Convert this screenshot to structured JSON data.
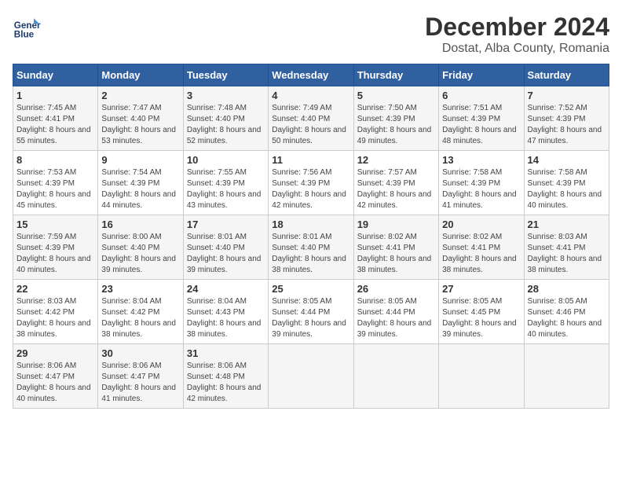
{
  "header": {
    "logo_line1": "General",
    "logo_line2": "Blue",
    "title": "December 2024",
    "subtitle": "Dostat, Alba County, Romania"
  },
  "days_of_week": [
    "Sunday",
    "Monday",
    "Tuesday",
    "Wednesday",
    "Thursday",
    "Friday",
    "Saturday"
  ],
  "weeks": [
    [
      {
        "day": 1,
        "sunrise": "7:45 AM",
        "sunset": "4:41 PM",
        "daylight": "8 hours and 55 minutes."
      },
      {
        "day": 2,
        "sunrise": "7:47 AM",
        "sunset": "4:40 PM",
        "daylight": "8 hours and 53 minutes."
      },
      {
        "day": 3,
        "sunrise": "7:48 AM",
        "sunset": "4:40 PM",
        "daylight": "8 hours and 52 minutes."
      },
      {
        "day": 4,
        "sunrise": "7:49 AM",
        "sunset": "4:40 PM",
        "daylight": "8 hours and 50 minutes."
      },
      {
        "day": 5,
        "sunrise": "7:50 AM",
        "sunset": "4:39 PM",
        "daylight": "8 hours and 49 minutes."
      },
      {
        "day": 6,
        "sunrise": "7:51 AM",
        "sunset": "4:39 PM",
        "daylight": "8 hours and 48 minutes."
      },
      {
        "day": 7,
        "sunrise": "7:52 AM",
        "sunset": "4:39 PM",
        "daylight": "8 hours and 47 minutes."
      }
    ],
    [
      {
        "day": 8,
        "sunrise": "7:53 AM",
        "sunset": "4:39 PM",
        "daylight": "8 hours and 45 minutes."
      },
      {
        "day": 9,
        "sunrise": "7:54 AM",
        "sunset": "4:39 PM",
        "daylight": "8 hours and 44 minutes."
      },
      {
        "day": 10,
        "sunrise": "7:55 AM",
        "sunset": "4:39 PM",
        "daylight": "8 hours and 43 minutes."
      },
      {
        "day": 11,
        "sunrise": "7:56 AM",
        "sunset": "4:39 PM",
        "daylight": "8 hours and 42 minutes."
      },
      {
        "day": 12,
        "sunrise": "7:57 AM",
        "sunset": "4:39 PM",
        "daylight": "8 hours and 42 minutes."
      },
      {
        "day": 13,
        "sunrise": "7:58 AM",
        "sunset": "4:39 PM",
        "daylight": "8 hours and 41 minutes."
      },
      {
        "day": 14,
        "sunrise": "7:58 AM",
        "sunset": "4:39 PM",
        "daylight": "8 hours and 40 minutes."
      }
    ],
    [
      {
        "day": 15,
        "sunrise": "7:59 AM",
        "sunset": "4:39 PM",
        "daylight": "8 hours and 40 minutes."
      },
      {
        "day": 16,
        "sunrise": "8:00 AM",
        "sunset": "4:40 PM",
        "daylight": "8 hours and 39 minutes."
      },
      {
        "day": 17,
        "sunrise": "8:01 AM",
        "sunset": "4:40 PM",
        "daylight": "8 hours and 39 minutes."
      },
      {
        "day": 18,
        "sunrise": "8:01 AM",
        "sunset": "4:40 PM",
        "daylight": "8 hours and 38 minutes."
      },
      {
        "day": 19,
        "sunrise": "8:02 AM",
        "sunset": "4:41 PM",
        "daylight": "8 hours and 38 minutes."
      },
      {
        "day": 20,
        "sunrise": "8:02 AM",
        "sunset": "4:41 PM",
        "daylight": "8 hours and 38 minutes."
      },
      {
        "day": 21,
        "sunrise": "8:03 AM",
        "sunset": "4:41 PM",
        "daylight": "8 hours and 38 minutes."
      }
    ],
    [
      {
        "day": 22,
        "sunrise": "8:03 AM",
        "sunset": "4:42 PM",
        "daylight": "8 hours and 38 minutes."
      },
      {
        "day": 23,
        "sunrise": "8:04 AM",
        "sunset": "4:42 PM",
        "daylight": "8 hours and 38 minutes."
      },
      {
        "day": 24,
        "sunrise": "8:04 AM",
        "sunset": "4:43 PM",
        "daylight": "8 hours and 38 minutes."
      },
      {
        "day": 25,
        "sunrise": "8:05 AM",
        "sunset": "4:44 PM",
        "daylight": "8 hours and 39 minutes."
      },
      {
        "day": 26,
        "sunrise": "8:05 AM",
        "sunset": "4:44 PM",
        "daylight": "8 hours and 39 minutes."
      },
      {
        "day": 27,
        "sunrise": "8:05 AM",
        "sunset": "4:45 PM",
        "daylight": "8 hours and 39 minutes."
      },
      {
        "day": 28,
        "sunrise": "8:05 AM",
        "sunset": "4:46 PM",
        "daylight": "8 hours and 40 minutes."
      }
    ],
    [
      {
        "day": 29,
        "sunrise": "8:06 AM",
        "sunset": "4:47 PM",
        "daylight": "8 hours and 40 minutes."
      },
      {
        "day": 30,
        "sunrise": "8:06 AM",
        "sunset": "4:47 PM",
        "daylight": "8 hours and 41 minutes."
      },
      {
        "day": 31,
        "sunrise": "8:06 AM",
        "sunset": "4:48 PM",
        "daylight": "8 hours and 42 minutes."
      },
      null,
      null,
      null,
      null
    ]
  ],
  "labels": {
    "sunrise": "Sunrise:",
    "sunset": "Sunset:",
    "daylight": "Daylight:"
  }
}
